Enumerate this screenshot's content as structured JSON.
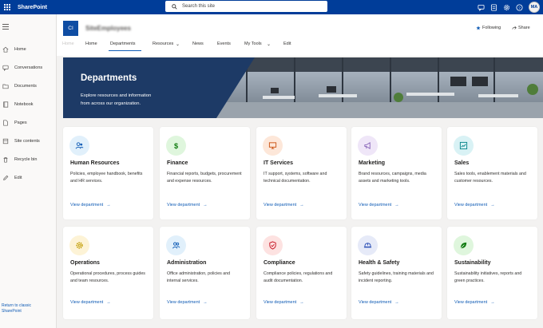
{
  "suite": {
    "brand": "SharePoint",
    "search_placeholder": "Search this site",
    "avatar_initials": "MA"
  },
  "leftnav": {
    "items": [
      {
        "label": "Home",
        "icon": "home-icon"
      },
      {
        "label": "Conversations",
        "icon": "conversations-icon"
      },
      {
        "label": "Documents",
        "icon": "documents-icon"
      },
      {
        "label": "Notebook",
        "icon": "notebook-icon"
      },
      {
        "label": "Pages",
        "icon": "pages-icon"
      },
      {
        "label": "Site contents",
        "icon": "site-contents-icon"
      },
      {
        "label": "Recycle bin",
        "icon": "recycle-bin-icon"
      },
      {
        "label": "Edit",
        "icon": "edit-icon"
      }
    ],
    "return_line1": "Return to classic",
    "return_line2": "SharePoint"
  },
  "site": {
    "logo_initials": "CI",
    "title": "SiteEmployees",
    "following": "Following",
    "share": "Share"
  },
  "topnav": {
    "faded": "Home",
    "items": [
      "Home",
      "Departments",
      "Resources",
      "News",
      "Events",
      "My Tools",
      "Edit"
    ]
  },
  "hero": {
    "title": "Departments",
    "subtitle_line1": "Explore resources and information",
    "subtitle_line2": "from across our organization."
  },
  "cards": [
    {
      "title": "Human Resources",
      "desc": "Policies, employee handbook, benefits and HR services.",
      "link": "View department",
      "icon": "people-icon",
      "icon_bg": "#e1f0fb",
      "icon_color": "#0f5bb5"
    },
    {
      "title": "Finance",
      "desc": "Financial reports, budgets, procurement and expense resources.",
      "link": "View department",
      "icon": "dollar-icon",
      "icon_bg": "#dff6dd",
      "icon_color": "#107c10"
    },
    {
      "title": "IT Services",
      "desc": "IT support, systems, software and technical documentation.",
      "link": "View department",
      "icon": "monitor-icon",
      "icon_bg": "#fde7d9",
      "icon_color": "#ca5010"
    },
    {
      "title": "Marketing",
      "desc": "Brand resources, campaigns, media assets and marketing tools.",
      "link": "View department",
      "icon": "megaphone-icon",
      "icon_bg": "#efe6f8",
      "icon_color": "#8764b8"
    },
    {
      "title": "Sales",
      "desc": "Sales tools, enablement materials and customer resources.",
      "link": "View department",
      "icon": "chart-icon",
      "icon_bg": "#d9f2f5",
      "icon_color": "#038387"
    },
    {
      "title": "Operations",
      "desc": "Operational procedures, process guides and team resources.",
      "link": "View department",
      "icon": "gear-icon",
      "icon_bg": "#fdf3d6",
      "icon_color": "#c19c00"
    },
    {
      "title": "Administration",
      "desc": "Office administration, policies and internal services.",
      "link": "View department",
      "icon": "admin-people-icon",
      "icon_bg": "#e1f0fb",
      "icon_color": "#0f5bb5"
    },
    {
      "title": "Compliance",
      "desc": "Compliance policies, regulations and audit documentation.",
      "link": "View department",
      "icon": "shield-icon",
      "icon_bg": "#fde2e1",
      "icon_color": "#c50f1f"
    },
    {
      "title": "Health & Safety",
      "desc": "Safety guidelines, training materials and incident reporting.",
      "link": "View department",
      "icon": "hardhat-icon",
      "icon_bg": "#e6eaf8",
      "icon_color": "#2b4fb5"
    },
    {
      "title": "Sustainability",
      "desc": "Sustainability initiatives, reports and green practices.",
      "link": "View department",
      "icon": "leaf-icon",
      "icon_bg": "#dff6dd",
      "icon_color": "#107c10"
    }
  ]
}
